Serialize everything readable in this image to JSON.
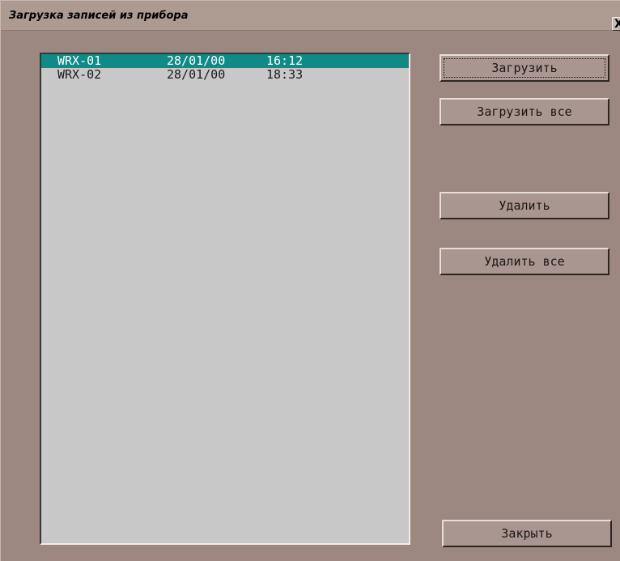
{
  "window": {
    "title": "Загрузка записей из прибора",
    "close_label": "X"
  },
  "records": {
    "items": [
      {
        "name": "WRX-01",
        "date": "28/01/00",
        "time": "16:12",
        "selected": true
      },
      {
        "name": "WRX-02",
        "date": "28/01/00",
        "time": "18:33",
        "selected": false
      }
    ]
  },
  "buttons": {
    "load": "Загрузить",
    "load_all": "Загрузить все",
    "delete": "Удалить",
    "delete_all": "Удалить все",
    "close": "Закрыть"
  },
  "colors": {
    "window_bg": "#9c8880",
    "list_bg": "#c8c8c8",
    "selection_bg": "#0f8a86"
  }
}
